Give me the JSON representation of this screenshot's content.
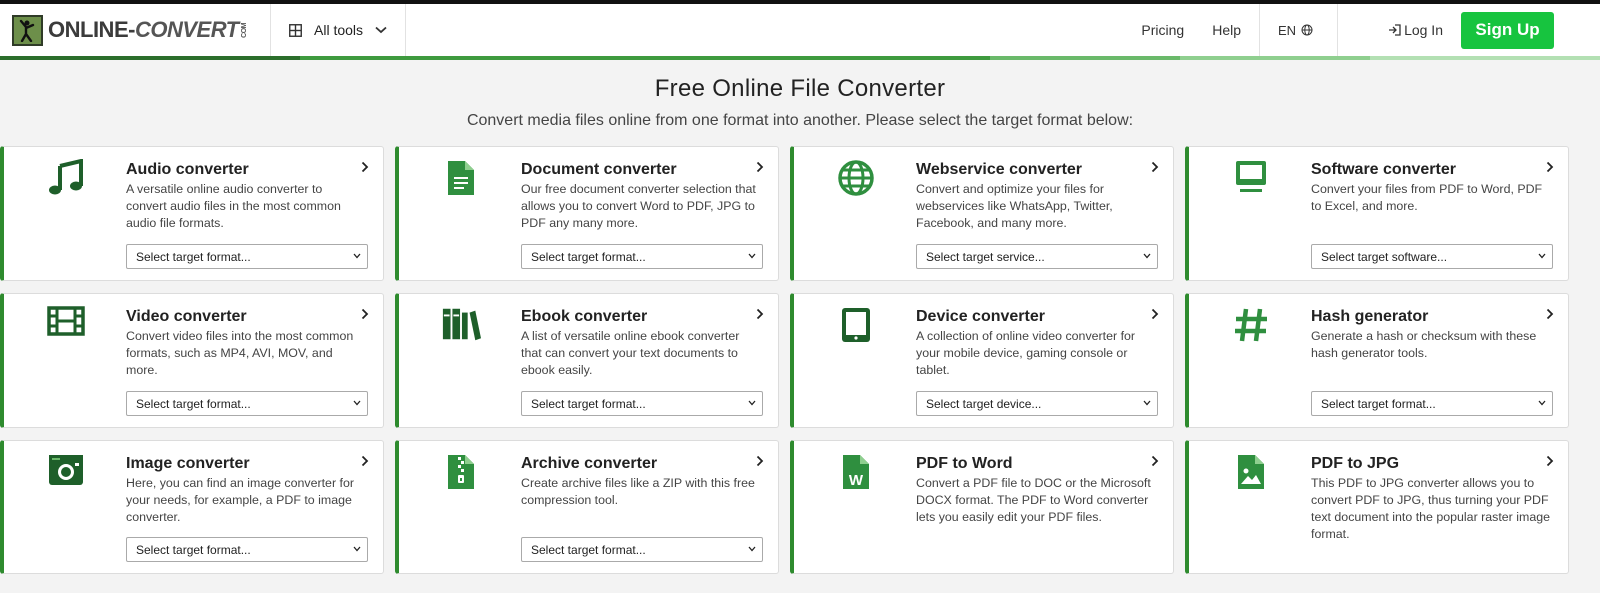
{
  "header": {
    "logo_main": "ONLINE-",
    "logo_conv": "CONVERT",
    "logo_suffix": "COM",
    "all_tools": "All tools",
    "pricing": "Pricing",
    "help": "Help",
    "language": "EN",
    "login": "Log In",
    "signup": "Sign Up"
  },
  "hero": {
    "title": "Free Online File Converter",
    "subtitle": "Convert media files online from one format into another. Please select the target format below:"
  },
  "colors": {
    "accent_green": "#2e8b2e",
    "signup_green": "#17c43f",
    "icon_dark_green": "#1e5f2a",
    "icon_green": "#2f8f3f"
  },
  "cards": [
    {
      "title": "Audio converter",
      "desc": "A versatile online audio converter to convert audio files in the most common audio file formats.",
      "select": "Select target format...",
      "icon": "music-note-icon"
    },
    {
      "title": "Document converter",
      "desc": "Our free document converter selection that allows you to convert Word to PDF, JPG to PDF any many more.",
      "select": "Select target format...",
      "icon": "document-icon"
    },
    {
      "title": "Webservice converter",
      "desc": "Convert and optimize your files for webservices like WhatsApp, Twitter, Facebook, and many more.",
      "select": "Select target service...",
      "icon": "globe-icon"
    },
    {
      "title": "Software converter",
      "desc": "Convert your files from PDF to Word, PDF to Excel, and more.",
      "select": "Select target software...",
      "icon": "monitor-icon"
    },
    {
      "title": "Video converter",
      "desc": "Convert video files into the most common formats, such as MP4, AVI, MOV, and more.",
      "select": "Select target format...",
      "icon": "film-icon"
    },
    {
      "title": "Ebook converter",
      "desc": "A list of versatile online ebook converter that can convert your text documents to ebook easily.",
      "select": "Select target format...",
      "icon": "books-icon"
    },
    {
      "title": "Device converter",
      "desc": "A collection of online video converter for your mobile device, gaming console or tablet.",
      "select": "Select target device...",
      "icon": "tablet-icon"
    },
    {
      "title": "Hash generator",
      "desc": "Generate a hash or checksum with these hash generator tools.",
      "select": "Select target format...",
      "icon": "hash-icon"
    },
    {
      "title": "Image converter",
      "desc": "Here, you can find an image converter for your needs, for example, a PDF to image converter.",
      "select": "Select target format...",
      "icon": "camera-icon"
    },
    {
      "title": "Archive converter",
      "desc": "Create archive files like a ZIP with this free compression tool.",
      "select": "Select target format...",
      "icon": "zip-file-icon"
    },
    {
      "title": "PDF to Word",
      "desc": "Convert a PDF file to DOC or the Microsoft DOCX format. The PDF to Word converter lets you easily edit your PDF files.",
      "select": "",
      "icon": "word-file-icon"
    },
    {
      "title": "PDF to JPG",
      "desc": "This PDF to JPG converter allows you to convert PDF to JPG, thus turning your PDF text document into the popular raster image format.",
      "select": "",
      "icon": "image-file-icon"
    }
  ]
}
